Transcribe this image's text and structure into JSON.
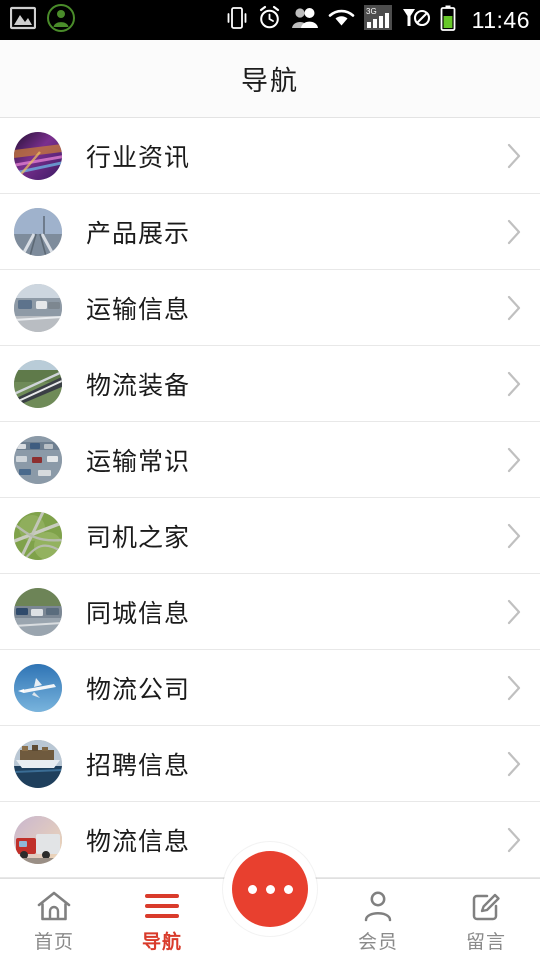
{
  "statusbar": {
    "time": "11:46",
    "left_icons": [
      {
        "name": "gallery-icon"
      },
      {
        "name": "contact-account-icon"
      }
    ],
    "right_icons": [
      {
        "name": "vibrate-icon"
      },
      {
        "name": "alarm-icon"
      },
      {
        "name": "people-icon"
      },
      {
        "name": "wifi-icon"
      },
      {
        "name": "signal-3g-icon",
        "label": "3G"
      },
      {
        "name": "no-sim-signal-icon"
      },
      {
        "name": "battery-icon"
      }
    ]
  },
  "header": {
    "title": "导航"
  },
  "list": {
    "items": [
      {
        "label": "行业资讯",
        "thumb": "city-night-traffic"
      },
      {
        "label": "产品展示",
        "thumb": "railway-track"
      },
      {
        "label": "运输信息",
        "thumb": "highway-trucks"
      },
      {
        "label": "物流装备",
        "thumb": "road-guardrail"
      },
      {
        "label": "运输常识",
        "thumb": "traffic-jam"
      },
      {
        "label": "司机之家",
        "thumb": "aerial-interchange"
      },
      {
        "label": "同城信息",
        "thumb": "city-street-cars"
      },
      {
        "label": "物流公司",
        "thumb": "airplane-sky"
      },
      {
        "label": "招聘信息",
        "thumb": "cargo-ship-port"
      },
      {
        "label": "物流信息",
        "thumb": "red-truck"
      }
    ],
    "chevron_icon": "chevron-right-icon"
  },
  "tabbar": {
    "items": [
      {
        "label": "首页",
        "icon": "home-icon",
        "active": false
      },
      {
        "label": "导航",
        "icon": "menu-hamburger-icon",
        "active": true
      },
      {
        "label": "会员",
        "icon": "person-icon",
        "active": false
      },
      {
        "label": "留言",
        "icon": "edit-message-icon",
        "active": false
      }
    ],
    "fab": {
      "name": "more-fab",
      "icon": "ellipsis-icon"
    }
  },
  "colors": {
    "accent_red": "#d93b2b",
    "fab_red": "#e8402f",
    "inactive_gray": "#8a8a8a",
    "status_bar_bg": "#000000",
    "header_bg": "#fbfbfb",
    "divider": "#e8e8e8"
  }
}
